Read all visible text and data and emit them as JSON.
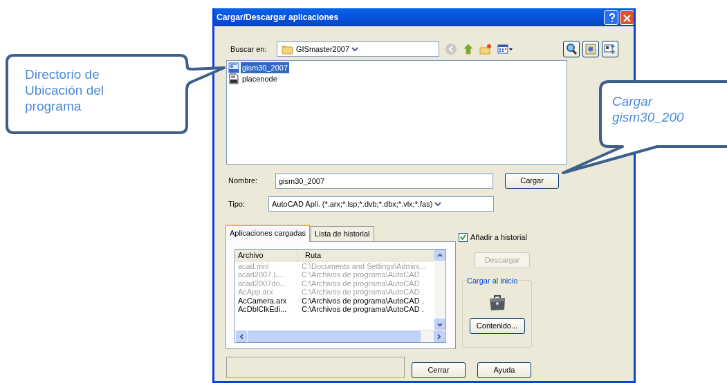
{
  "window": {
    "title": "Cargar/Descargar aplicaciones"
  },
  "look_in": {
    "label": "Buscar en:",
    "value": "GISmaster2007"
  },
  "files": [
    {
      "name": "gism30_2007",
      "kind": "arx",
      "selected": true
    },
    {
      "name": "placenode",
      "kind": "lsp",
      "selected": false
    }
  ],
  "name_field": {
    "label": "Nombre:",
    "value": "gism30_2007"
  },
  "load_button": "Cargar",
  "type_field": {
    "label": "Tipo:",
    "value": "AutoCAD Apli. (*.arx;*.lsp;*.dvb;*.dbx;*.vlx;*.fas)"
  },
  "tabs": [
    {
      "label": "Aplicaciones cargadas",
      "selected": true
    },
    {
      "label": "Lista de historial",
      "selected": false
    }
  ],
  "loaded_apps": {
    "columns": [
      "Archivo",
      "Ruta"
    ],
    "rows": [
      {
        "file": "acad.mnl",
        "path": "C:\\Documents and Settings\\Admini...",
        "greyed": true
      },
      {
        "file": "acad2007.L...",
        "path": "C:\\Archivos de programa\\AutoCAD .",
        "greyed": true
      },
      {
        "file": "acad2007do...",
        "path": "C:\\Archivos de programa\\AutoCAD .",
        "greyed": true
      },
      {
        "file": "AcApp.arx",
        "path": "C:\\Archivos de programa\\AutoCAD .",
        "greyed": true
      },
      {
        "file": "AcCamera.arx",
        "path": "C:\\Archivos de programa\\AutoCAD .",
        "greyed": false
      },
      {
        "file": "AcDblClkEdi...",
        "path": "C:\\Archivos de programa\\AutoCAD .",
        "greyed": false
      }
    ]
  },
  "add_to_history": {
    "label": "Añadir a historial",
    "checked": true
  },
  "unload_button": {
    "label": "Descargar",
    "disabled": true
  },
  "startup_group": {
    "title": "Cargar al inicio",
    "button": "Contenido..."
  },
  "bottom_buttons": [
    "Cerrar",
    "Ayuda"
  ],
  "callouts": [
    {
      "text": "Directorio de Ubicación del programa",
      "italic": false
    },
    {
      "text": "Cargar gism30_200",
      "italic": true
    }
  ]
}
